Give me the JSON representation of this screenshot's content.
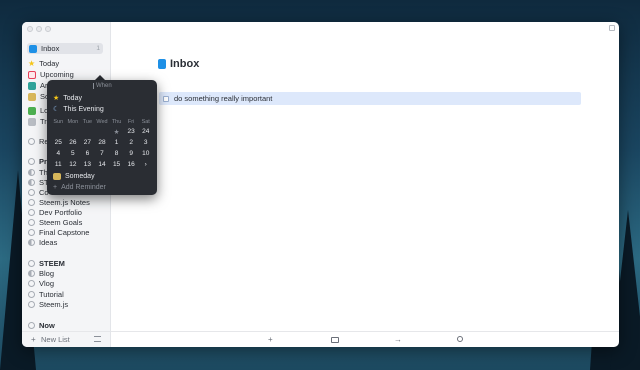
{
  "window": {
    "title": ""
  },
  "sidebar": {
    "inbox": {
      "label": "Inbox",
      "count": "1"
    },
    "today": "Today",
    "upcoming": "Upcoming",
    "anytime_partial": "Ar",
    "someday_partial": "So",
    "logbook_partial": "Lo",
    "trash_partial": "Tr",
    "repeating_partial": "Re",
    "projects_partial": "Pr",
    "proj_items_partial": [
      "Th",
      "ST",
      "Co"
    ],
    "projects": [
      "Steem.js Notes",
      "Dev Portfolio",
      "Steem Goals",
      "Final Capstone",
      "Ideas"
    ],
    "steem_header": "STEEM",
    "steem_items": [
      "Blog",
      "Vlog",
      "Tutorial",
      "Steem.js"
    ],
    "now": "Now",
    "new_list": "New List"
  },
  "main": {
    "title": "Inbox",
    "task": "do something really important"
  },
  "popover": {
    "when": "When",
    "today": "Today",
    "this_evening": "This Evening",
    "weekdays": [
      "Sun",
      "Mon",
      "Tue",
      "Wed",
      "Thu",
      "Fri",
      "Sat"
    ],
    "rows": [
      [
        "",
        "",
        "",
        "",
        "★",
        "23",
        "24"
      ],
      [
        "25",
        "26",
        "27",
        "28",
        "1",
        "2",
        "3"
      ],
      [
        "4",
        "5",
        "6",
        "7",
        "8",
        "9",
        "10"
      ],
      [
        "11",
        "12",
        "13",
        "14",
        "15",
        "16",
        "›"
      ]
    ],
    "someday": "Someday",
    "add_reminder": "Add Reminder"
  },
  "icons": {
    "plus": "+",
    "calendar": "calendar-icon",
    "arrow": "→",
    "search": "search-icon"
  }
}
